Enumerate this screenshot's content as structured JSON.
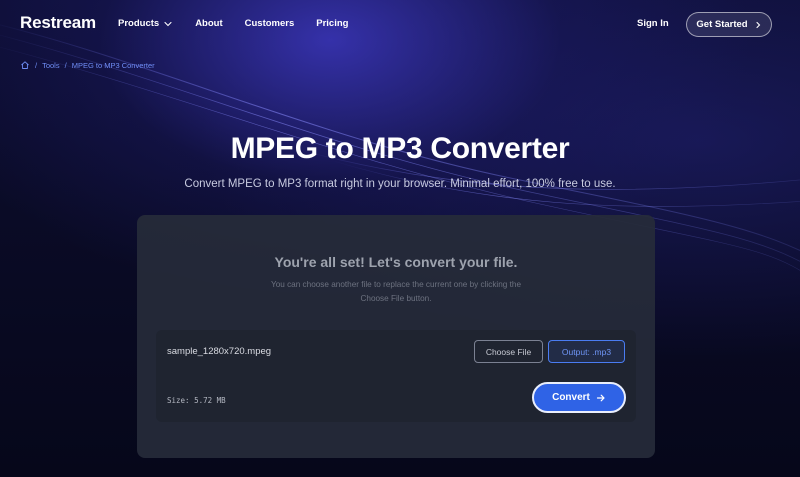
{
  "nav": {
    "logo": "Restream",
    "links": [
      "Products",
      "About",
      "Customers",
      "Pricing"
    ],
    "sign_in": "Sign In",
    "get_started": "Get Started"
  },
  "breadcrumb": {
    "tools": "Tools",
    "separator": "/",
    "current": "MPEG to MP3 Converter"
  },
  "hero": {
    "title": "MPEG to MP3 Converter",
    "subtitle": "Convert MPEG to MP3 format right in your browser. Minimal effort, 100% free to use."
  },
  "card": {
    "title": "You're all set! Let's convert your file.",
    "help": "You can choose another file to replace the current one by clicking the Choose File button.",
    "file_name": "sample_1280x720.mpeg",
    "choose_file": "Choose File",
    "output": "Output: .mp3",
    "size": "Size: 5.72 MB",
    "convert": "Convert"
  },
  "colors": {
    "accent": "#2f63e6",
    "link": "#6f8df5",
    "card_bg": "#262b3a"
  },
  "icons": {
    "home": "home-icon",
    "products_chevron": "chevron-down-icon",
    "get_started_chevron": "chevron-right-icon",
    "convert_arrow": "arrow-right-icon"
  }
}
